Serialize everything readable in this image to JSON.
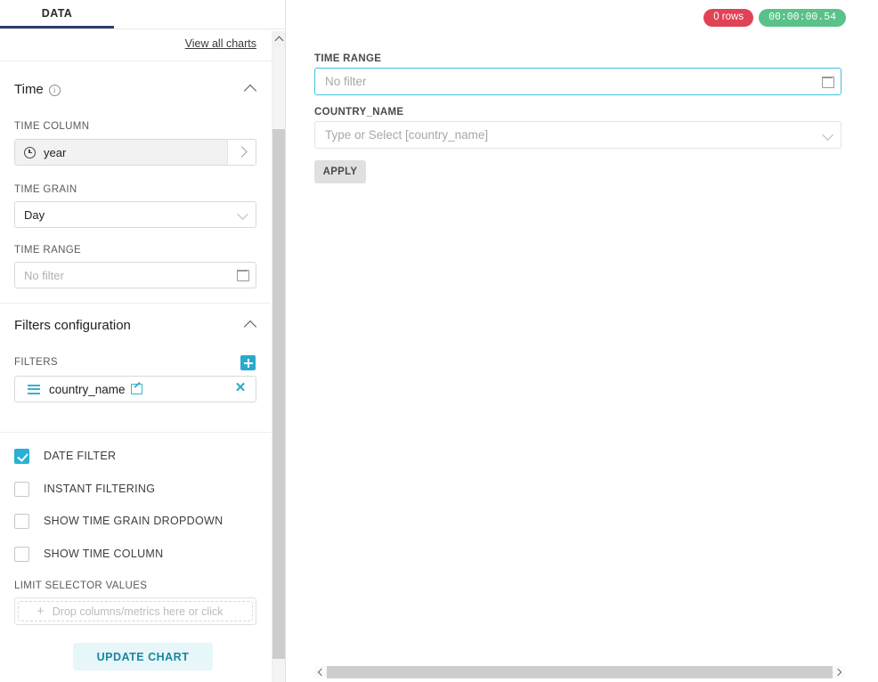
{
  "left_panel": {
    "tabs": [
      {
        "label": "DATA",
        "active": true
      }
    ],
    "view_all_charts_link": "View all charts",
    "time_section": {
      "title": "Time",
      "info_icon": "info-circle-icon",
      "collapse_icon": "chevron-up-icon",
      "time_column": {
        "label": "TIME COLUMN",
        "value": "year",
        "icon": "clock-icon",
        "arrow_icon": "chevron-right-icon"
      },
      "time_grain": {
        "label": "TIME GRAIN",
        "value": "Day",
        "arrow_icon": "chevron-down-icon"
      },
      "time_range": {
        "label": "TIME RANGE",
        "placeholder": "No filter",
        "icon": "calendar-icon"
      }
    },
    "filters_section": {
      "title": "Filters configuration",
      "collapse_icon": "chevron-up-icon",
      "filters_label": "FILTERS",
      "add_button_icon": "plus-icon",
      "filter_items": [
        {
          "name": "country_name",
          "drag_icon": "hamburger-drag-icon",
          "edit_icon": "edit-pencil-icon",
          "remove_icon": "close-x-icon"
        }
      ],
      "checkboxes": [
        {
          "label": "DATE FILTER",
          "checked": true
        },
        {
          "label": "INSTANT FILTERING",
          "checked": false
        },
        {
          "label": "SHOW TIME GRAIN DROPDOWN",
          "checked": false
        },
        {
          "label": "SHOW TIME COLUMN",
          "checked": false
        }
      ],
      "limit_selector": {
        "label": "LIMIT SELECTOR VALUES",
        "placeholder": "Drop columns/metrics here or click",
        "plus_icon": "plus-icon"
      }
    },
    "update_chart_button": "UPDATE CHART",
    "scrollbar": {
      "up_icon": "chevron-up-icon"
    }
  },
  "right_panel": {
    "badges": {
      "rows": "0 rows",
      "rows_color": "#e04355",
      "timer": "00:00:00.54",
      "timer_color": "#5ac189"
    },
    "filter_form": {
      "time_range": {
        "label": "TIME RANGE",
        "placeholder": "No filter",
        "icon": "calendar-icon",
        "focused": true,
        "focus_color": "#44c0dd"
      },
      "country_name": {
        "label": "COUNTRY_NAME",
        "placeholder": "Type or Select [country_name]",
        "icon": "chevron-down-icon"
      },
      "apply_button": "APPLY"
    },
    "scrollbar": {
      "up_icon": "chevron-up-icon",
      "down_icon": "chevron-down-icon",
      "left_icon": "chevron-left-icon",
      "right_icon": "chevron-right-icon"
    }
  },
  "theme": {
    "accent_teal": "#2ba9cc",
    "tab_underline": "#2c3e6b",
    "update_chart_bg": "#e7f6f9",
    "update_chart_fg": "#1a85a0"
  }
}
